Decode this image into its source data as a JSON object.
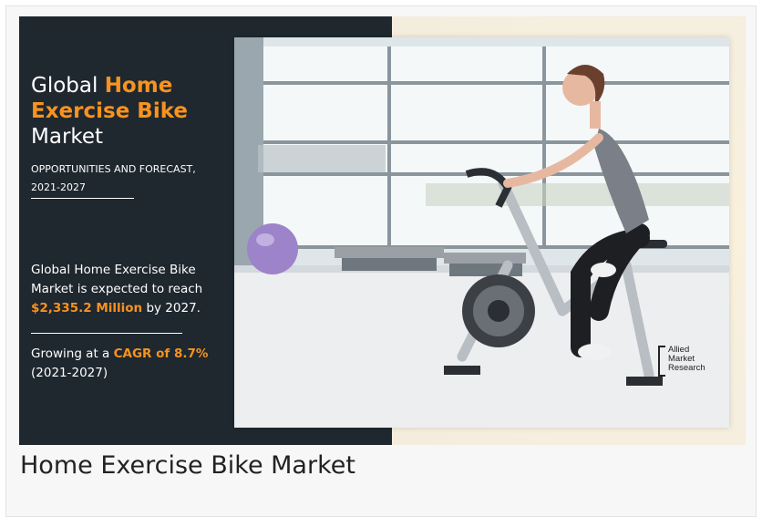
{
  "banner": {
    "title_prefix": "Global ",
    "title_highlight": "Home Exercise Bike",
    "title_suffix": "Market",
    "subtitle_line1": "OPPORTUNITIES AND FORECAST,",
    "subtitle_line2": "2021-2027",
    "desc_prefix": "Global Home Exercise Bike Market is expected to reach ",
    "desc_value": "$2,335.2 Million",
    "desc_suffix": " by 2027.",
    "growth_prefix": "Growing at a ",
    "growth_highlight": "CAGR of 8.7%",
    "growth_period": "(2021-2027)",
    "accent_color": "#f7931e",
    "panel_color": "#1f272f"
  },
  "logo": {
    "line1": "Allied",
    "line2": "Market",
    "line3": "Research"
  },
  "caption": "Home Exercise Bike Market"
}
